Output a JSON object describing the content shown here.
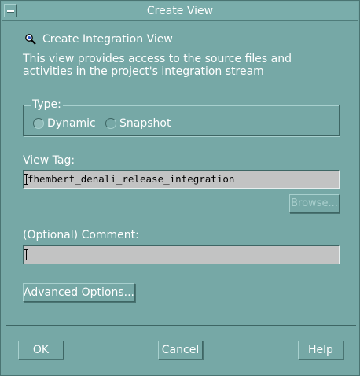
{
  "window": {
    "title": "Create View"
  },
  "header": {
    "title": "Create Integration View",
    "description_line1": "This view provides access to the source files and",
    "description_line2": "activities in the project's integration stream"
  },
  "type_group": {
    "label": "Type:",
    "options": [
      {
        "label": "Dynamic",
        "selected": true
      },
      {
        "label": "Snapshot",
        "selected": false
      }
    ]
  },
  "view_tag": {
    "label": "View Tag:",
    "value": "fhembert_denali_release_integration",
    "browse_label": "Browse..."
  },
  "comment": {
    "label": "(Optional) Comment:",
    "value": ""
  },
  "advanced_label": "Advanced Options...",
  "footer": {
    "ok_label": "OK",
    "cancel_label": "Cancel",
    "help_label": "Help"
  },
  "colors": {
    "background": "#76a8a6",
    "field_background": "#c2c3c3",
    "text": "#ffffff"
  },
  "icons": {
    "window_menu": "window-menu-icon",
    "heading": "magnifier-icon"
  }
}
